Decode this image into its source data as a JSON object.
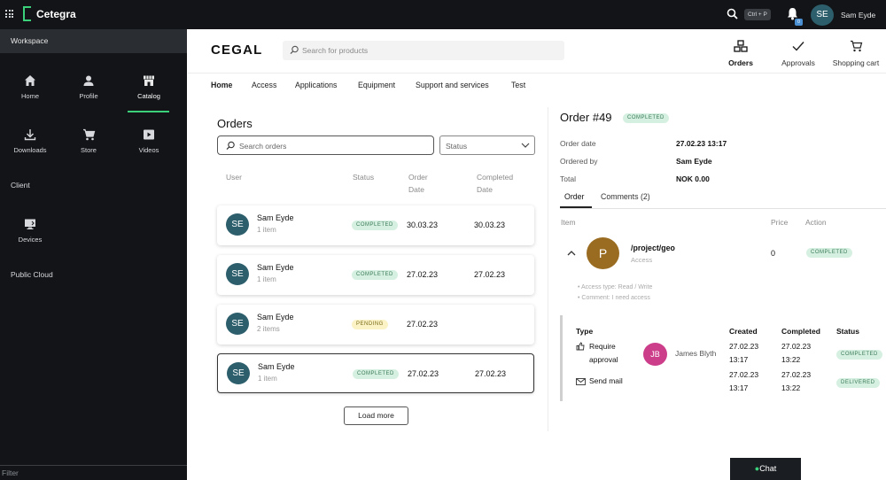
{
  "topbar": {
    "brand": "Cetegra",
    "shortcut": "Ctrl + P",
    "notification_count": "0",
    "user_initials": "SE",
    "user_name": "Sam Eyde"
  },
  "sidebar": {
    "workspace": "Workspace",
    "tiles": [
      {
        "label": "Home",
        "icon": "home-icon"
      },
      {
        "label": "Profile",
        "icon": "person-icon"
      },
      {
        "label": "Catalog",
        "icon": "store-icon",
        "active": true
      },
      {
        "label": "Downloads",
        "icon": "download-icon"
      },
      {
        "label": "Store",
        "icon": "cart-icon"
      },
      {
        "label": "Videos",
        "icon": "play-icon"
      },
      {
        "label": "Devices",
        "icon": "monitor-icon"
      }
    ],
    "client": "Client",
    "public_cloud": "Public Cloud",
    "filter_placeholder": "Filter"
  },
  "header": {
    "logo": "CEGAL",
    "search_placeholder": "Search for products",
    "actions": [
      {
        "label": "Orders",
        "icon": "orders-icon"
      },
      {
        "label": "Approvals",
        "icon": "check-icon"
      },
      {
        "label": "Shopping cart",
        "icon": "cart-icon"
      }
    ]
  },
  "nav": [
    "Home",
    "Access",
    "Applications",
    "Equipment",
    "Support and services",
    "Test"
  ],
  "orders": {
    "title": "Orders",
    "search_placeholder": "Search orders",
    "status_placeholder": "Status",
    "columns": {
      "user": "User",
      "status": "Status",
      "order_date": "Order Date",
      "completed_date": "Completed Date"
    },
    "rows": [
      {
        "initials": "SE",
        "user": "Sam Eyde",
        "items": "1 item",
        "status": "COMPLETED",
        "order_date": "30.03.23",
        "completed_date": "30.03.23"
      },
      {
        "initials": "SE",
        "user": "Sam Eyde",
        "items": "1 item",
        "status": "COMPLETED",
        "order_date": "27.02.23",
        "completed_date": "27.02.23"
      },
      {
        "initials": "SE",
        "user": "Sam Eyde",
        "items": "2 items",
        "status": "PENDING",
        "order_date": "27.02.23",
        "completed_date": ""
      },
      {
        "initials": "SE",
        "user": "Sam Eyde",
        "items": "1 item",
        "status": "COMPLETED",
        "order_date": "27.02.23",
        "completed_date": "27.02.23"
      }
    ],
    "load_more": "Load more"
  },
  "detail": {
    "title": "Order #49",
    "status": "COMPLETED",
    "order_date_label": "Order date",
    "order_date": "27.02.23 13:17",
    "ordered_by_label": "Ordered by",
    "ordered_by": "Sam Eyde",
    "total_label": "Total",
    "total": "NOK 0.00",
    "tabs": [
      "Order",
      "Comments (2)"
    ],
    "item_headers": {
      "item": "Item",
      "price": "Price",
      "action": "Action"
    },
    "item": {
      "initial": "P",
      "name": "/project/geo",
      "sub": "Access",
      "price": "0",
      "action": "COMPLETED",
      "details": [
        "Access type: Read / Write",
        "Comment: I need access"
      ]
    },
    "workflow": {
      "headers": {
        "type": "Type",
        "created": "Created",
        "completed": "Completed",
        "status": "Status"
      },
      "rows": [
        {
          "type_line1": "Require",
          "type_line2": "approval",
          "icon": "approval-icon",
          "assignee_initials": "JB",
          "assignee": "James Blyth",
          "created_date": "27.02.23",
          "created_time": "13:17",
          "completed_date": "27.02.23",
          "completed_time": "13:22",
          "status": "COMPLETED"
        },
        {
          "type_line1": "Send mail",
          "icon": "mail-icon",
          "created_date": "27.02.23",
          "created_time": "13:17",
          "completed_date": "27.02.23",
          "completed_time": "13:22",
          "status": "DELIVERED"
        }
      ]
    }
  },
  "chat": {
    "label": "Chat",
    "icon": "chat-icon"
  },
  "colors": {
    "accent": "#3ad17a",
    "avatar": "#2d5e6c",
    "topbar": "#121417"
  }
}
